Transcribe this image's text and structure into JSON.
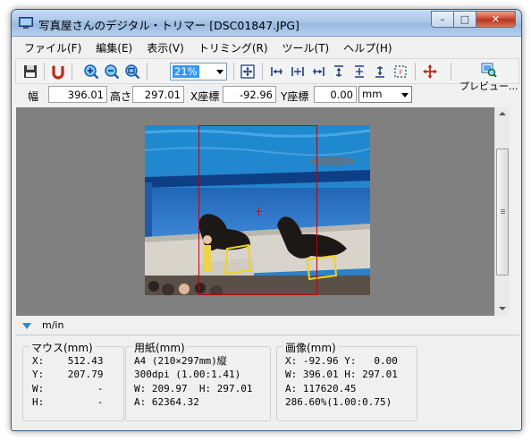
{
  "window": {
    "title": "写真屋さんのデジタル・トリマー [DSC01847.JPG]",
    "controls": {
      "minimize": "–",
      "maximize": "□",
      "close": "✕"
    }
  },
  "menu": [
    {
      "label": "ファイル(F)"
    },
    {
      "label": "編集(E)"
    },
    {
      "label": "表示(V)"
    },
    {
      "label": "トリミング(R)"
    },
    {
      "label": "ツール(T)"
    },
    {
      "label": "ヘルプ(H)"
    }
  ],
  "toolbar": {
    "zoom_value": "21%",
    "preview_label": "プレビュー..."
  },
  "params": {
    "width_label": "幅",
    "width_value": "396.01",
    "height_label": "高さ",
    "height_value": "297.01",
    "x_label": "X座標",
    "x_value": "-92.96",
    "y_label": "Y座標",
    "y_value": "0.00",
    "unit": "mm"
  },
  "unit_toggle_label": "m/in",
  "info": {
    "mouse": {
      "title": "マウス(mm)",
      "lines": [
        "X:    512.43",
        "Y:    207.79",
        "W:         -",
        "H:         -"
      ]
    },
    "paper": {
      "title": "用紙(mm)",
      "lines": [
        "A4 (210×297mm)縦",
        "300dpi (1.00:1.41)",
        "W: 209.97  H: 297.01",
        "A: 62364.32"
      ]
    },
    "image": {
      "title": "画像(mm)",
      "lines": [
        "X: -92.96 Y:   0.00",
        "W: 396.01 H: 297.01",
        "A: 117620.45",
        "286.60%(1.00:0.75)"
      ]
    }
  }
}
